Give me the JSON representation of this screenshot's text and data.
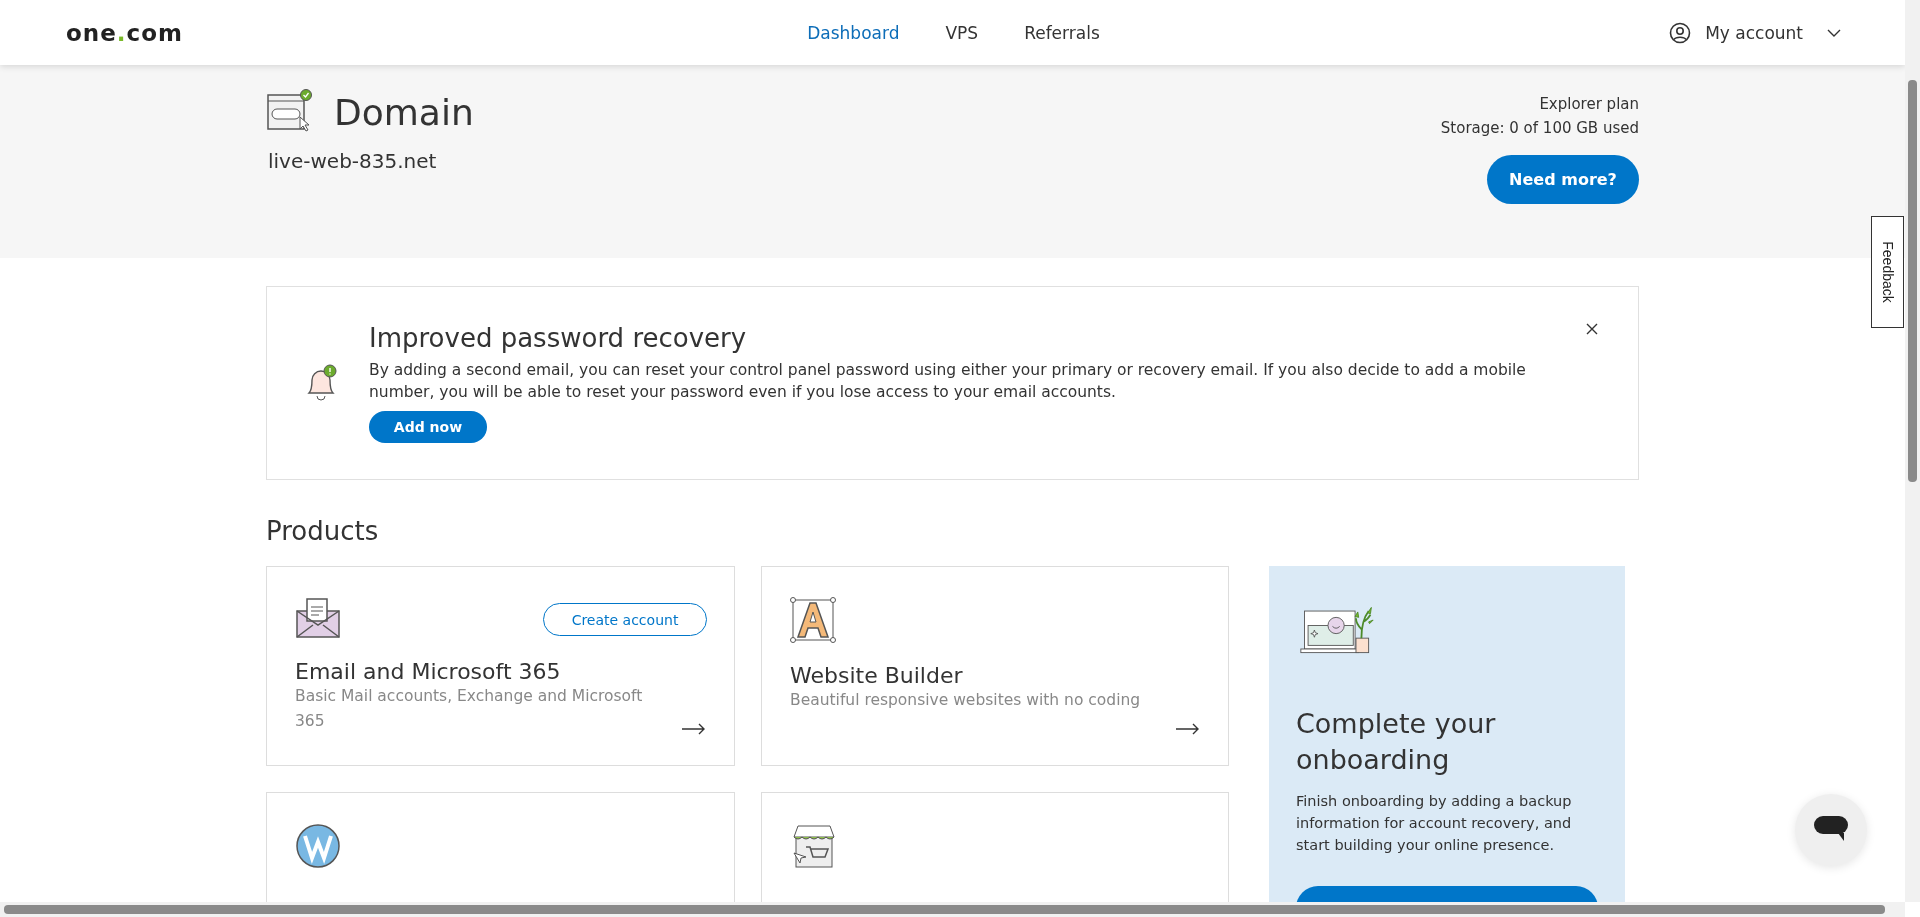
{
  "header": {
    "logo_parts": [
      "one",
      ".",
      "com"
    ],
    "nav": [
      {
        "label": "Dashboard",
        "selected": true
      },
      {
        "label": "VPS",
        "selected": false
      },
      {
        "label": "Referrals",
        "selected": false
      }
    ],
    "account": "My account"
  },
  "domain": {
    "title": "Domain",
    "name": "live-web-835.net",
    "plan": "Explorer plan",
    "storage": "Storage: 0 of 100 GB used",
    "button": "Need more?"
  },
  "feedback": "Feedback",
  "notice": {
    "title": "Improved password recovery",
    "body": "By adding a second email, you can reset your control panel password using either your primary or recovery email. If you also decide to add a mobile number, you will be able to reset your password even if you lose access to your email accounts.",
    "button": "Add now"
  },
  "products": {
    "heading": "Products",
    "cards": [
      {
        "kind": "mail",
        "title": "Email and Microsoft 365",
        "description": "Basic Mail accounts, Exchange and Microsoft 365",
        "action": "Create account"
      },
      {
        "kind": "builder",
        "title": "Website Builder",
        "description": "Beautiful responsive websites with no coding"
      },
      {
        "kind": "wordpress"
      },
      {
        "kind": "shop"
      }
    ]
  },
  "onboarding": {
    "title": "Complete your onboarding",
    "text": "Finish onboarding by adding a backup information for account recovery, and start building your online presence."
  }
}
